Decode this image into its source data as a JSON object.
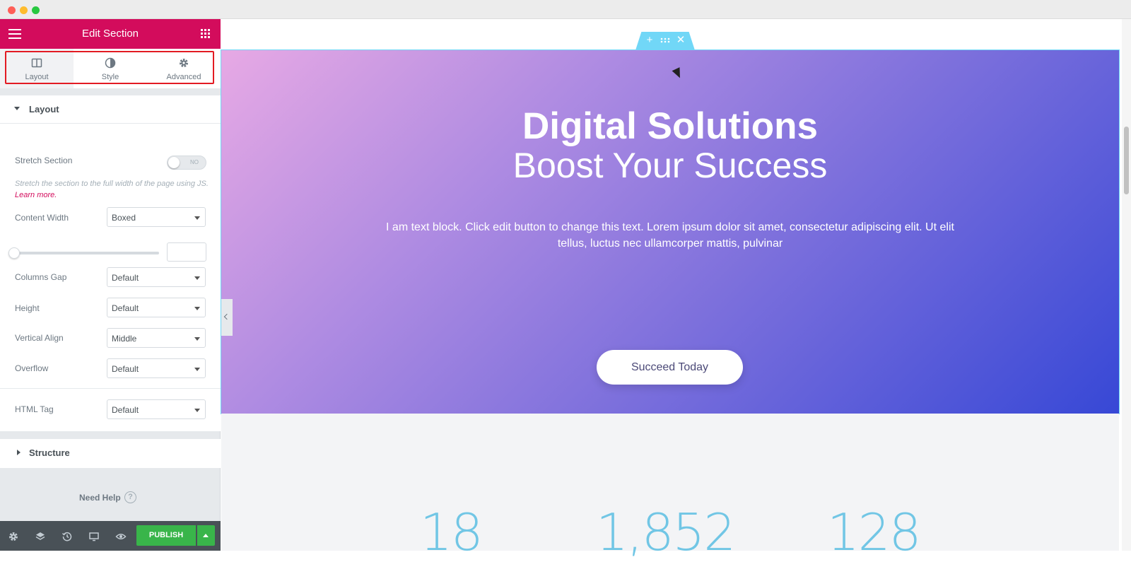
{
  "panel": {
    "title": "Edit Section",
    "tabs": [
      {
        "label": "Layout",
        "icon": "columns-icon"
      },
      {
        "label": "Style",
        "icon": "half-circle-icon"
      },
      {
        "label": "Advanced",
        "icon": "gear-icon"
      }
    ],
    "layout_section": {
      "title": "Layout",
      "stretch_label": "Stretch Section",
      "stretch_toggle": "NO",
      "stretch_desc": "Stretch the section to the full width of the page using JS.",
      "learn_more": "Learn more.",
      "content_width_label": "Content Width",
      "content_width_value": "Boxed",
      "columns_gap_label": "Columns Gap",
      "columns_gap_value": "Default",
      "height_label": "Height",
      "height_value": "Default",
      "vertical_align_label": "Vertical Align",
      "vertical_align_value": "Middle",
      "overflow_label": "Overflow",
      "overflow_value": "Default",
      "html_tag_label": "HTML Tag",
      "html_tag_value": "Default"
    },
    "structure_title": "Structure",
    "need_help": "Need Help",
    "help_glyph": "?",
    "publish": "PUBLISH"
  },
  "hero": {
    "heading": "Digital Solutions",
    "subheading": "Boost Your Success",
    "text": "I am text block. Click edit button to change this text. Lorem ipsum dolor sit amet, consectetur adipiscing elit. Ut elit tellus, luctus nec ullamcorper mattis, pulvinar",
    "button": "Succeed Today"
  },
  "stats": [
    "18",
    "1,852",
    "128"
  ],
  "colors": {
    "brand": "#d30c5c",
    "publish": "#39b54a",
    "section_outline": "#71d7f7",
    "stat_number": "#71c6e5"
  }
}
